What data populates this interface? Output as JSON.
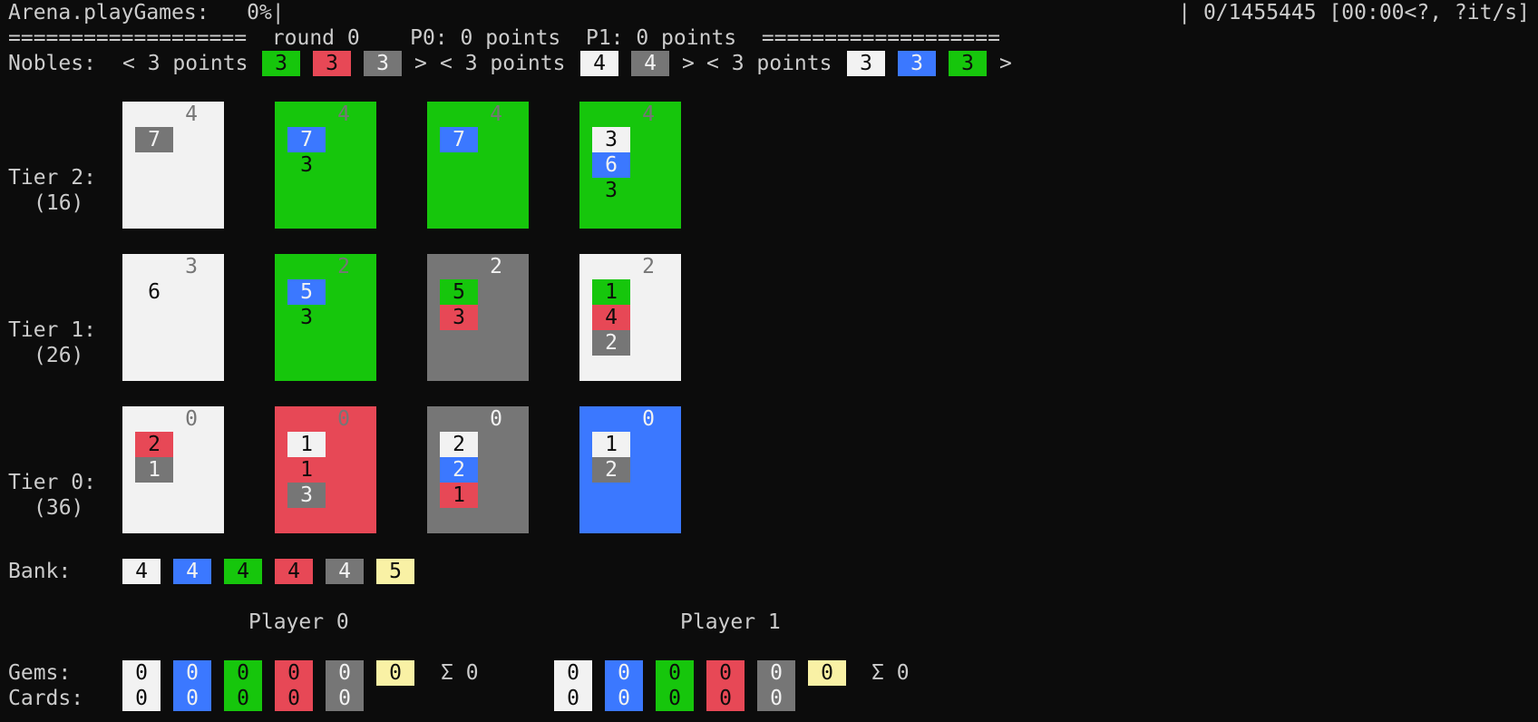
{
  "header": {
    "progress_left": "Arena.playGames:   0%|",
    "progress_right": "| 0/1455445 [00:00<?, ?it/s]",
    "round_line": "===================  round 0    P0: 0 points  P1: 0 points  ==================="
  },
  "colors": {
    "white": "#f2f2f2",
    "blue": "#3b78ff",
    "green": "#16c60c",
    "red": "#e74856",
    "grey": "#767676",
    "gold": "#f9f1a5",
    "background": "#0c0c0c"
  },
  "nobles": {
    "label": "Nobles:",
    "items": [
      {
        "open": "< 3 points",
        "close": ">",
        "chips": [
          {
            "color": "green",
            "value": "3"
          },
          {
            "color": "red",
            "value": "3"
          },
          {
            "color": "grey",
            "value": "3"
          }
        ]
      },
      {
        "open": "< 3 points",
        "close": ">",
        "chips": [
          {
            "color": "white",
            "value": "4"
          },
          {
            "color": "grey",
            "value": "4"
          }
        ]
      },
      {
        "open": "< 3 points",
        "close": ">",
        "chips": [
          {
            "color": "white",
            "value": "3"
          },
          {
            "color": "blue",
            "value": "3"
          },
          {
            "color": "green",
            "value": "3"
          }
        ]
      }
    ]
  },
  "tiers": [
    {
      "label": "Tier 2:",
      "count": "(16)",
      "cards": [
        {
          "color": "white",
          "points": "4",
          "costs": [
            {
              "type": "chip",
              "color": "grey",
              "value": "7"
            }
          ]
        },
        {
          "color": "green",
          "points": "4",
          "costs": [
            {
              "type": "chip",
              "color": "blue",
              "value": "7"
            },
            {
              "type": "text",
              "value": "3"
            }
          ]
        },
        {
          "color": "green",
          "points": "4",
          "costs": [
            {
              "type": "chip",
              "color": "blue",
              "value": "7"
            }
          ]
        },
        {
          "color": "green",
          "points": "4",
          "costs": [
            {
              "type": "chip",
              "color": "white",
              "value": "3"
            },
            {
              "type": "chip",
              "color": "blue",
              "value": "6"
            },
            {
              "type": "text",
              "value": "3"
            }
          ]
        }
      ]
    },
    {
      "label": "Tier 1:",
      "count": "(26)",
      "cards": [
        {
          "color": "white",
          "points": "3",
          "costs": [
            {
              "type": "text",
              "value": "6"
            }
          ]
        },
        {
          "color": "green",
          "points": "2",
          "costs": [
            {
              "type": "chip",
              "color": "blue",
              "value": "5"
            },
            {
              "type": "text",
              "value": "3"
            }
          ]
        },
        {
          "color": "grey",
          "points": "2",
          "costs": [
            {
              "type": "chip",
              "color": "green",
              "value": "5"
            },
            {
              "type": "chip",
              "color": "red",
              "value": "3"
            }
          ]
        },
        {
          "color": "white",
          "points": "2",
          "costs": [
            {
              "type": "chip",
              "color": "green",
              "value": "1"
            },
            {
              "type": "chip",
              "color": "red",
              "value": "4"
            },
            {
              "type": "chip",
              "color": "grey",
              "value": "2"
            }
          ]
        }
      ]
    },
    {
      "label": "Tier 0:",
      "count": "(36)",
      "cards": [
        {
          "color": "white",
          "points": "0",
          "costs": [
            {
              "type": "chip",
              "color": "red",
              "value": "2"
            },
            {
              "type": "chip",
              "color": "grey",
              "value": "1"
            }
          ]
        },
        {
          "color": "red",
          "points": "0",
          "costs": [
            {
              "type": "chip",
              "color": "white",
              "value": "1"
            },
            {
              "type": "text",
              "value": "1"
            },
            {
              "type": "chip",
              "color": "grey",
              "value": "3"
            }
          ]
        },
        {
          "color": "grey",
          "points": "0",
          "costs": [
            {
              "type": "chip",
              "color": "white",
              "value": "2"
            },
            {
              "type": "chip",
              "color": "blue",
              "value": "2"
            },
            {
              "type": "chip",
              "color": "red",
              "value": "1"
            }
          ]
        },
        {
          "color": "blue",
          "points": "0",
          "costs": [
            {
              "type": "chip",
              "color": "white",
              "value": "1"
            },
            {
              "type": "chip",
              "color": "grey",
              "value": "2"
            }
          ]
        }
      ]
    }
  ],
  "bank": {
    "label": "Bank:",
    "chips": [
      {
        "color": "white",
        "value": "4"
      },
      {
        "color": "blue",
        "value": "4"
      },
      {
        "color": "green",
        "value": "4"
      },
      {
        "color": "red",
        "value": "4"
      },
      {
        "color": "grey",
        "value": "4"
      },
      {
        "color": "gold",
        "value": "5"
      }
    ]
  },
  "players": {
    "gems_label": "Gems:",
    "cards_label": "Cards:",
    "list": [
      {
        "name": "Player 0",
        "gems": [
          {
            "color": "white",
            "value": "0"
          },
          {
            "color": "blue",
            "value": "0"
          },
          {
            "color": "green",
            "value": "0"
          },
          {
            "color": "red",
            "value": "0"
          },
          {
            "color": "grey",
            "value": "0"
          },
          {
            "color": "gold",
            "value": "0"
          }
        ],
        "sum": "Σ 0",
        "cards": [
          {
            "color": "white",
            "value": "0"
          },
          {
            "color": "blue",
            "value": "0"
          },
          {
            "color": "green",
            "value": "0"
          },
          {
            "color": "red",
            "value": "0"
          },
          {
            "color": "grey",
            "value": "0"
          }
        ]
      },
      {
        "name": "Player 1",
        "gems": [
          {
            "color": "white",
            "value": "0"
          },
          {
            "color": "blue",
            "value": "0"
          },
          {
            "color": "green",
            "value": "0"
          },
          {
            "color": "red",
            "value": "0"
          },
          {
            "color": "grey",
            "value": "0"
          },
          {
            "color": "gold",
            "value": "0"
          }
        ],
        "sum": "Σ 0",
        "cards": [
          {
            "color": "white",
            "value": "0"
          },
          {
            "color": "blue",
            "value": "0"
          },
          {
            "color": "green",
            "value": "0"
          },
          {
            "color": "red",
            "value": "0"
          },
          {
            "color": "grey",
            "value": "0"
          }
        ]
      }
    ]
  }
}
